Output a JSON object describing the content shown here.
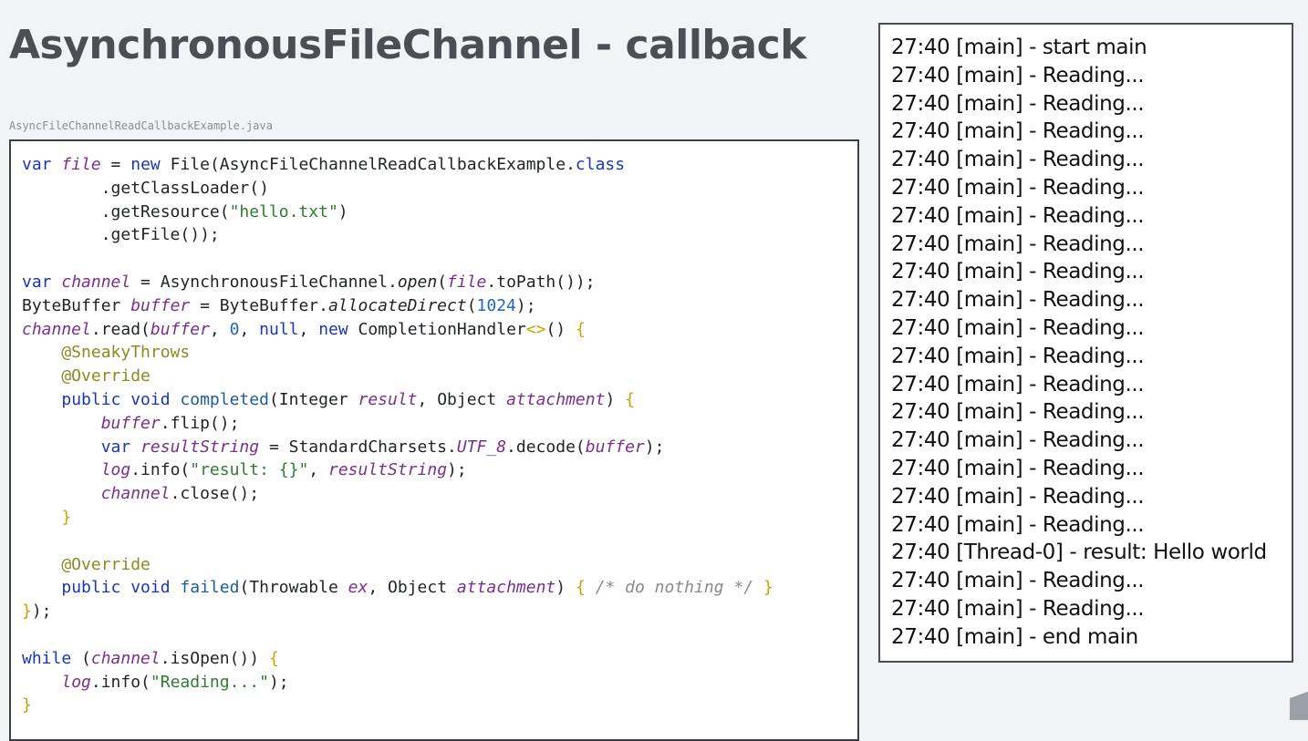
{
  "slide": {
    "title": "AsynchronousFileChannel - callback",
    "filename": "AsyncFileChannelReadCallbackExample.java"
  },
  "code": {
    "colors": {
      "keyword": "#1b35b5",
      "variable": "#7a2f8f",
      "string": "#2e7d32",
      "number": "#1e64c8",
      "annotation": "#8c8a22",
      "comment": "#8a8a8a",
      "plain": "#1f2328",
      "brace": "#c9a200"
    },
    "lines": [
      [
        [
          "var ",
          "keyword"
        ],
        [
          "file",
          "variable-italic"
        ],
        [
          " = ",
          "plain"
        ],
        [
          "new ",
          "keyword"
        ],
        [
          "File(AsyncFileChannelReadCallbackExample.",
          "plain"
        ],
        [
          "class",
          "keyword"
        ]
      ],
      [
        [
          "        .getClassLoader()",
          "plain"
        ]
      ],
      [
        [
          "        .getResource(",
          "plain"
        ],
        [
          "\"hello.txt\"",
          "string"
        ],
        [
          ")",
          "plain"
        ]
      ],
      [
        [
          "        .getFile());",
          "plain"
        ]
      ],
      [],
      [
        [
          "var ",
          "keyword"
        ],
        [
          "channel",
          "variable-italic"
        ],
        [
          " = AsynchronousFileChannel.",
          "plain"
        ],
        [
          "open",
          "italic"
        ],
        [
          "(",
          "plain"
        ],
        [
          "file",
          "variable-italic"
        ],
        [
          ".toPath());",
          "plain"
        ]
      ],
      [
        [
          "ByteBuffer ",
          "plain"
        ],
        [
          "buffer",
          "variable-italic"
        ],
        [
          " = ByteBuffer.",
          "plain"
        ],
        [
          "allocateDirect",
          "italic"
        ],
        [
          "(",
          "plain"
        ],
        [
          "1024",
          "number"
        ],
        [
          ");",
          "plain"
        ]
      ],
      [
        [
          "channel",
          "variable-italic"
        ],
        [
          ".read(",
          "plain"
        ],
        [
          "buffer",
          "variable-italic"
        ],
        [
          ", ",
          "plain"
        ],
        [
          "0",
          "number"
        ],
        [
          ", ",
          "plain"
        ],
        [
          "null",
          "keyword"
        ],
        [
          ", ",
          "plain"
        ],
        [
          "new ",
          "keyword"
        ],
        [
          "CompletionHandler",
          "plain"
        ],
        [
          "<>",
          "brace"
        ],
        [
          "() ",
          "plain"
        ],
        [
          "{",
          "brace"
        ]
      ],
      [
        [
          "    @SneakyThrows",
          "annotation"
        ]
      ],
      [
        [
          "    @Override",
          "annotation"
        ]
      ],
      [
        [
          "    ",
          "plain"
        ],
        [
          "public void ",
          "keyword"
        ],
        [
          "completed",
          "method"
        ],
        [
          "(Integer ",
          "plain"
        ],
        [
          "result",
          "variable-italic"
        ],
        [
          ", Object ",
          "plain"
        ],
        [
          "attachment",
          "variable-italic"
        ],
        [
          ") ",
          "plain"
        ],
        [
          "{",
          "brace"
        ]
      ],
      [
        [
          "        ",
          "plain"
        ],
        [
          "buffer",
          "variable-italic"
        ],
        [
          ".flip();",
          "plain"
        ]
      ],
      [
        [
          "        ",
          "plain"
        ],
        [
          "var ",
          "keyword"
        ],
        [
          "resultString",
          "variable-italic"
        ],
        [
          " = StandardCharsets.",
          "plain"
        ],
        [
          "UTF_8",
          "variable-italic"
        ],
        [
          ".decode(",
          "plain"
        ],
        [
          "buffer",
          "variable-italic"
        ],
        [
          ");",
          "plain"
        ]
      ],
      [
        [
          "        ",
          "plain"
        ],
        [
          "log",
          "variable-italic"
        ],
        [
          ".info(",
          "plain"
        ],
        [
          "\"result: {}\"",
          "string"
        ],
        [
          ", ",
          "plain"
        ],
        [
          "resultString",
          "variable-italic"
        ],
        [
          ");",
          "plain"
        ]
      ],
      [
        [
          "        ",
          "plain"
        ],
        [
          "channel",
          "variable-italic"
        ],
        [
          ".close();",
          "plain"
        ]
      ],
      [
        [
          "    ",
          "plain"
        ],
        [
          "}",
          "brace"
        ]
      ],
      [],
      [
        [
          "    @Override",
          "annotation"
        ]
      ],
      [
        [
          "    ",
          "plain"
        ],
        [
          "public void ",
          "keyword"
        ],
        [
          "failed",
          "method"
        ],
        [
          "(Throwable ",
          "plain"
        ],
        [
          "ex",
          "variable-italic"
        ],
        [
          ", Object ",
          "plain"
        ],
        [
          "attachment",
          "variable-italic"
        ],
        [
          ") ",
          "plain"
        ],
        [
          "{ ",
          "brace"
        ],
        [
          "/* do nothing */",
          "comment"
        ],
        [
          " }",
          "brace"
        ]
      ],
      [
        [
          "}",
          "brace"
        ],
        [
          ");",
          "plain"
        ]
      ],
      [],
      [
        [
          "while ",
          "keyword"
        ],
        [
          "(",
          "plain"
        ],
        [
          "channel",
          "variable-italic"
        ],
        [
          ".isOpen()) ",
          "plain"
        ],
        [
          "{",
          "brace"
        ]
      ],
      [
        [
          "    ",
          "plain"
        ],
        [
          "log",
          "variable-italic"
        ],
        [
          ".info(",
          "plain"
        ],
        [
          "\"Reading...\"",
          "string"
        ],
        [
          ");",
          "plain"
        ]
      ],
      [
        [
          "}",
          "brace"
        ]
      ]
    ]
  },
  "log": {
    "lines": [
      "27:40 [main] - start main",
      "27:40 [main] - Reading...",
      "27:40 [main] - Reading...",
      "27:40 [main] - Reading...",
      "27:40 [main] - Reading...",
      "27:40 [main] - Reading...",
      "27:40 [main] - Reading...",
      "27:40 [main] - Reading...",
      "27:40 [main] - Reading...",
      "27:40 [main] - Reading...",
      "27:40 [main] - Reading...",
      "27:40 [main] - Reading...",
      "27:40 [main] - Reading...",
      "27:40 [main] - Reading...",
      "27:40 [main] - Reading...",
      "27:40 [main] - Reading...",
      "27:40 [main] - Reading...",
      "27:40 [main] - Reading...",
      "27:40 [Thread-0] - result: Hello world",
      "27:40 [main] - Reading...",
      "27:40 [main] - Reading...",
      "27:40 [main] - end main"
    ]
  }
}
